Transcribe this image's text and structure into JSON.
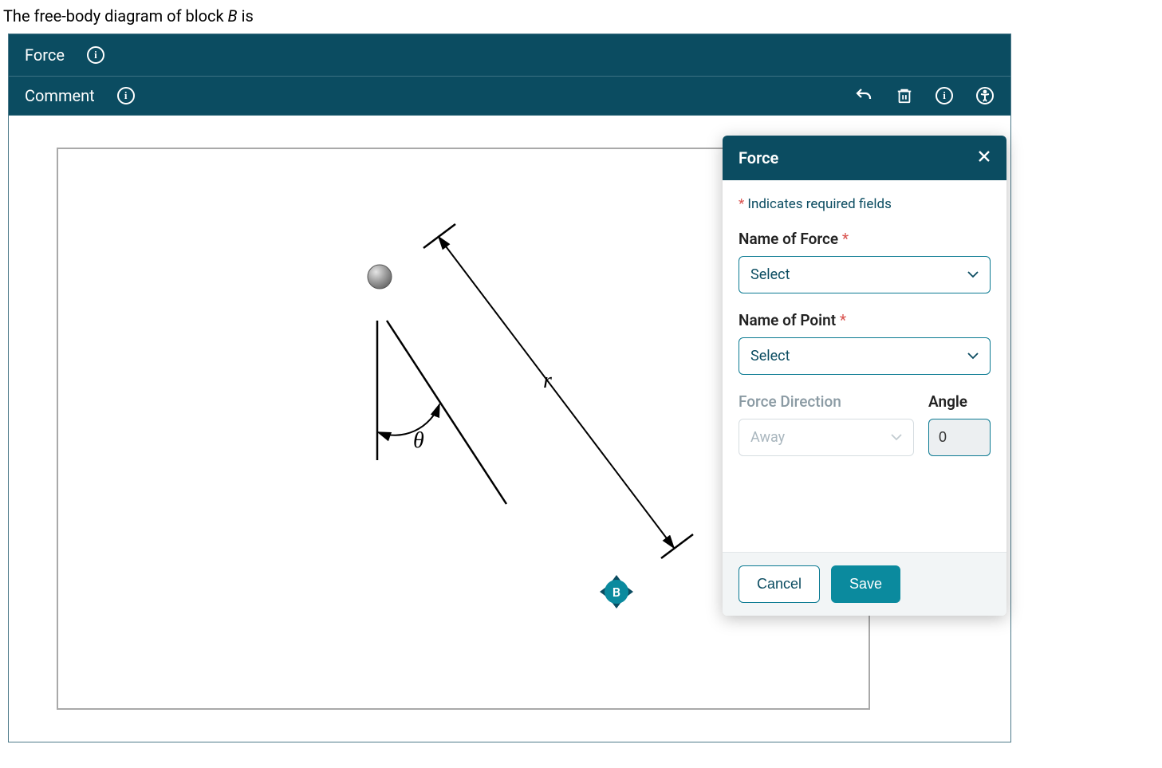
{
  "prompt": {
    "pre": "The free-body diagram of block ",
    "var": "B",
    "post": " is"
  },
  "bars": {
    "force_label": "Force",
    "comment_label": "Comment"
  },
  "diagram": {
    "r_label": "r",
    "theta_label": "θ",
    "point_b_label": "B"
  },
  "panel": {
    "title": "Force",
    "required_note": "Indicates required fields",
    "name_of_force_label": "Name of Force",
    "name_of_force_value": "Select",
    "name_of_point_label": "Name of Point",
    "name_of_point_value": "Select",
    "force_direction_label": "Force Direction",
    "force_direction_value": "Away",
    "angle_label": "Angle",
    "angle_value": "0",
    "cancel_label": "Cancel",
    "save_label": "Save"
  }
}
